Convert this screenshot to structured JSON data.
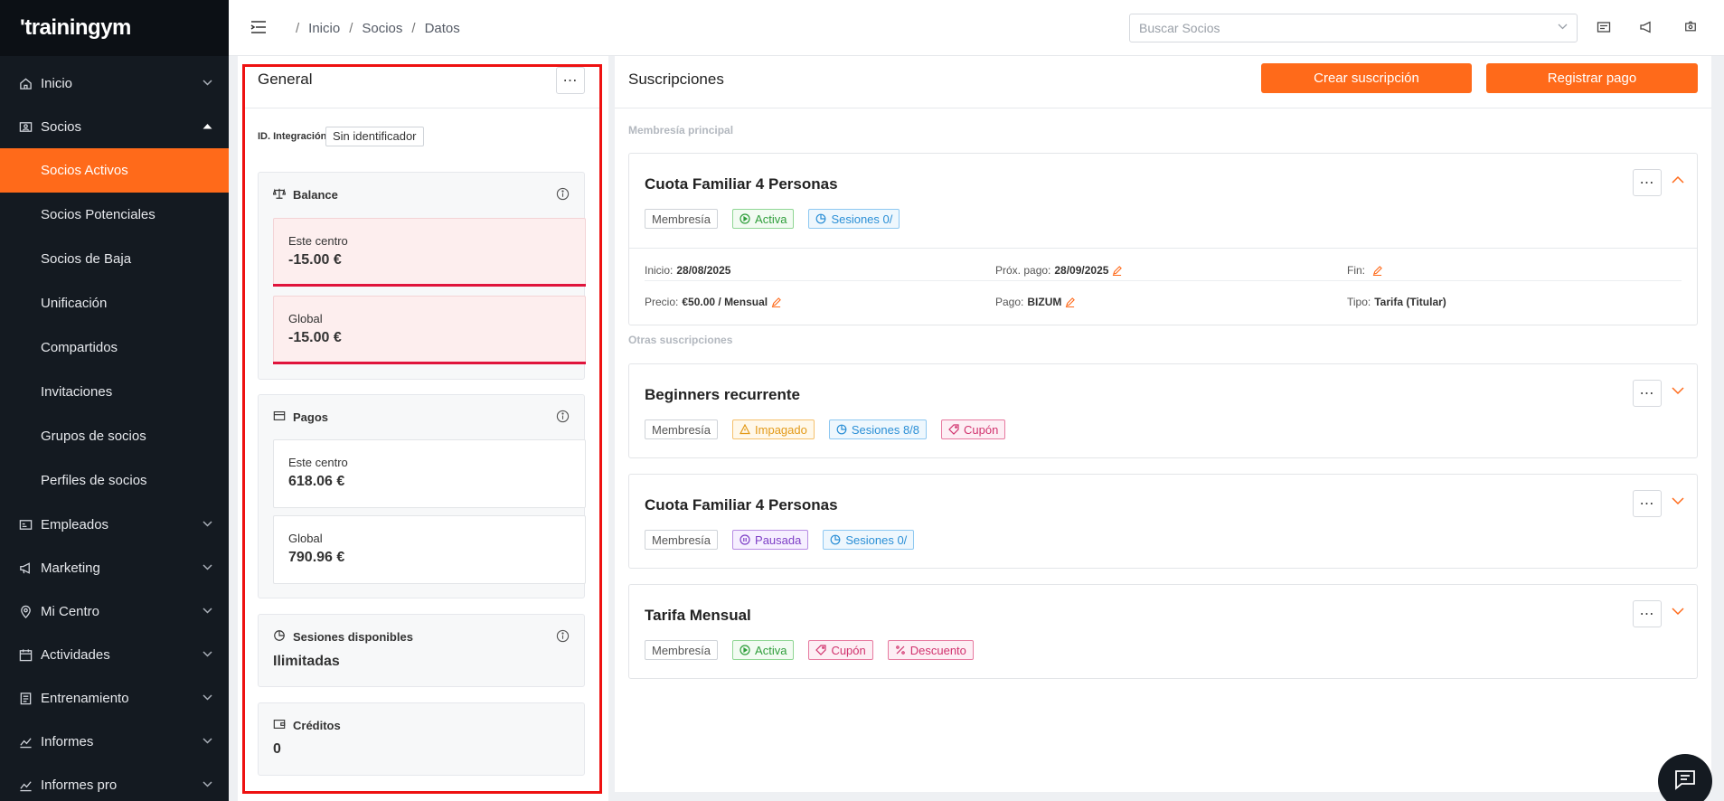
{
  "app": {
    "logo_text": "'trainingym"
  },
  "sidebar": {
    "items": [
      {
        "label": "Inicio",
        "icon": "home-icon",
        "expanded": false
      },
      {
        "label": "Socios",
        "icon": "members-icon",
        "expanded": true
      },
      {
        "label": "Empleados",
        "icon": "id-card-icon",
        "expanded": false
      },
      {
        "label": "Marketing",
        "icon": "megaphone-icon",
        "expanded": false
      },
      {
        "label": "Mi Centro",
        "icon": "location-pin-icon",
        "expanded": false
      },
      {
        "label": "Actividades",
        "icon": "calendar-icon",
        "expanded": false
      },
      {
        "label": "Entrenamiento",
        "icon": "clipboard-icon",
        "expanded": false
      },
      {
        "label": "Informes",
        "icon": "trend-icon",
        "expanded": false
      },
      {
        "label": "Informes pro",
        "icon": "trend-pro-icon",
        "expanded": false
      }
    ],
    "socios_subitems": [
      "Socios Activos",
      "Socios Potenciales",
      "Socios de Baja",
      "Unificación",
      "Compartidos",
      "Invitaciones",
      "Grupos de socios",
      "Perfiles de socios"
    ],
    "active_subitem": "Socios Activos"
  },
  "topbar": {
    "breadcrumb": [
      "Inicio",
      "Socios",
      "Datos"
    ],
    "search_placeholder": "Buscar Socios"
  },
  "general": {
    "title": "General",
    "integration_label": "ID. Integración",
    "integration_value": "Sin identificador",
    "balance": {
      "title": "Balance",
      "center_label": "Este centro",
      "center_value": "-15.00 €",
      "global_label": "Global",
      "global_value": "-15.00 €"
    },
    "pagos": {
      "title": "Pagos",
      "center_label": "Este centro",
      "center_value": "618.06 €",
      "global_label": "Global",
      "global_value": "790.96 €"
    },
    "sesiones": {
      "title": "Sesiones disponibles",
      "value": "Ilimitadas"
    },
    "creditos": {
      "title": "Créditos",
      "value": "0"
    }
  },
  "subscriptions": {
    "title": "Suscripciones",
    "create_button": "Crear suscripción",
    "payment_button": "Registrar pago",
    "main_label": "Membresía principal",
    "other_label": "Otras suscripciones",
    "main": {
      "name": "Cuota Familiar 4 Personas",
      "tags": [
        "Membresía",
        "Activa",
        "Sesiones 0/"
      ],
      "inicio_label": "Inicio:",
      "inicio_value": "28/08/2025",
      "prox_label": "Próx. pago:",
      "prox_value": "28/09/2025",
      "fin_label": "Fin:",
      "fin_value": "",
      "precio_label": "Precio:",
      "precio_value": "€50.00 / Mensual",
      "pago_label": "Pago:",
      "pago_value": "BIZUM",
      "tipo_label": "Tipo:",
      "tipo_value": "Tarifa (Titular)"
    },
    "others": [
      {
        "name": "Beginners recurrente",
        "tags": [
          "Membresía",
          "Impagado",
          "Sesiones 8/8",
          "Cupón"
        ]
      },
      {
        "name": "Cuota Familiar 4 Personas",
        "tags": [
          "Membresía",
          "Pausada",
          "Sesiones 0/"
        ]
      },
      {
        "name": "Tarifa Mensual",
        "tags": [
          "Membresía",
          "Activa",
          "Cupón",
          "Descuento"
        ]
      }
    ]
  },
  "colors": {
    "accent": "#ff6a1a",
    "sidebar_bg": "#141a21",
    "negative": "#e0143c",
    "highlight": "#ee1111"
  }
}
